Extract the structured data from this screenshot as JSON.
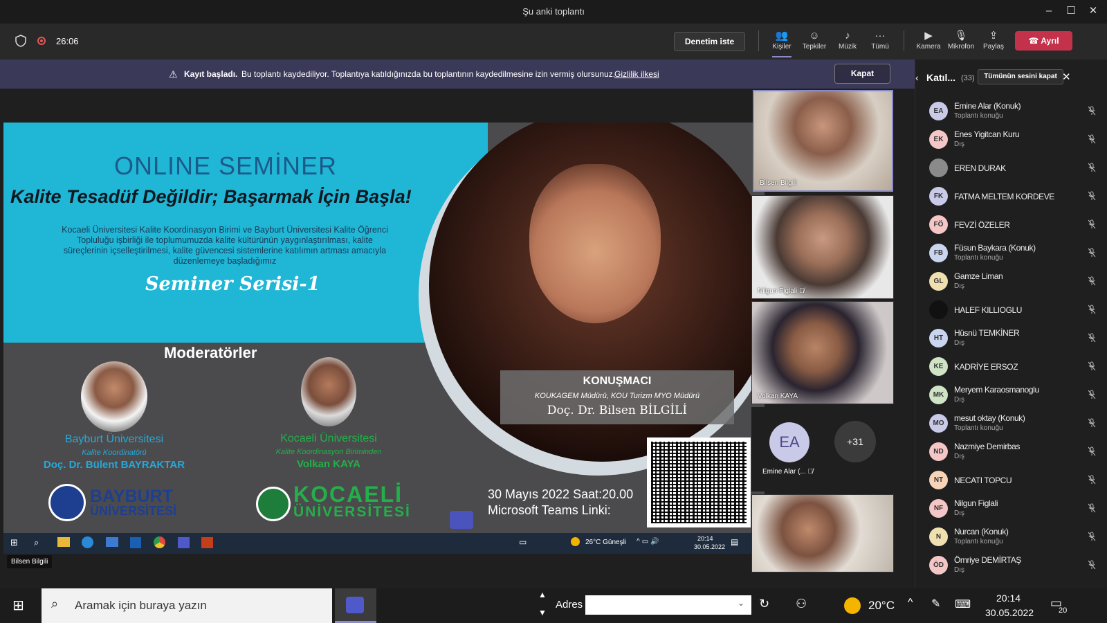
{
  "window": {
    "title": "Şu anki toplantı",
    "minimize_icon": "–",
    "maximize_icon": "☐",
    "close_icon": "✕"
  },
  "toolbar": {
    "timer": "26:06",
    "request_control": "Denetim iste",
    "buttons": [
      {
        "label": "Kişiler",
        "icon": "people-icon"
      },
      {
        "label": "Tepkiler",
        "icon": "reactions-icon"
      },
      {
        "label": "Müzik",
        "icon": "music-icon"
      },
      {
        "label": "Tümü",
        "icon": "more-icon"
      },
      {
        "label": "Kamera",
        "icon": "camera-icon"
      },
      {
        "label": "Mikrofon",
        "icon": "microphone-icon"
      },
      {
        "label": "Paylaş",
        "icon": "share-icon"
      }
    ],
    "leave": "Ayrıl"
  },
  "banner": {
    "title": "Kayıt başladı.",
    "message": "Bu toplantı kaydediliyor. Toplantıya katıldığınızda bu toplantının kaydedilmesine izin vermiş olursunuz.",
    "link": "Gizlilik ilkesi",
    "close": "Kapat"
  },
  "panel": {
    "title": "Katıl...",
    "count": "(33)",
    "mute_all": "Tümünün sesini kapat",
    "participants": [
      {
        "initials": "EA",
        "name": "Emine Alar (Konuk)",
        "role": "Toplantı konuğu",
        "color": "#c9c9e8"
      },
      {
        "initials": "EK",
        "name": "Enes Yigitcan Kuru",
        "role": "Dış",
        "color": "#f4c6c6"
      },
      {
        "initials": "",
        "name": "EREN DURAK",
        "role": "",
        "color": "#8a8a8a"
      },
      {
        "initials": "FK",
        "name": "FATMA MELTEM KORDEVE",
        "role": "",
        "color": "#c9c9e8"
      },
      {
        "initials": "FÖ",
        "name": "FEVZİ ÖZELER",
        "role": "",
        "color": "#f4c6c6"
      },
      {
        "initials": "FB",
        "name": "Füsun Baykara (Konuk)",
        "role": "Toplantı konuğu",
        "color": "#c9d4ee"
      },
      {
        "initials": "GL",
        "name": "Gamze Liman",
        "role": "Dış",
        "color": "#f0e0b0"
      },
      {
        "initials": "",
        "name": "HALEF KILLIOGLU",
        "role": "",
        "color": "#111111"
      },
      {
        "initials": "HT",
        "name": "Hüsnü TEMKİNER",
        "role": "Dış",
        "color": "#c9d4ee"
      },
      {
        "initials": "KE",
        "name": "KADRİYE ERSOZ",
        "role": "",
        "color": "#cfe3c5"
      },
      {
        "initials": "MK",
        "name": "Meryem Karaosmanoglu",
        "role": "Dış",
        "color": "#cfe3c5"
      },
      {
        "initials": "MO",
        "name": "mesut oktay (Konuk)",
        "role": "Toplantı konuğu",
        "color": "#c9c9e8"
      },
      {
        "initials": "ND",
        "name": "Nazmiye Demirbas",
        "role": "Dış",
        "color": "#f4c6c6"
      },
      {
        "initials": "NT",
        "name": "NECATI TOPCU",
        "role": "",
        "color": "#f7d3b8"
      },
      {
        "initials": "NF",
        "name": "Nilgun Figlali",
        "role": "Dış",
        "color": "#f4c6c6"
      },
      {
        "initials": "N",
        "name": "Nurcan (Konuk)",
        "role": "Toplantı konuğu",
        "color": "#f0e0b0"
      },
      {
        "initials": "ÖD",
        "name": "Ömriye DEMİRTAŞ",
        "role": "Dış",
        "color": "#f4c6c6"
      }
    ]
  },
  "videos": [
    {
      "name": "Bilsen Bilgili"
    },
    {
      "name": "Nilgun Figlali"
    },
    {
      "name": "Volkan KAYA"
    }
  ],
  "avatar_tile": {
    "initials": "EA",
    "name": "Emine Alar (...",
    "overflow": "+31"
  },
  "speaker_label": "Bilsen Bilgili",
  "slide": {
    "heading": "ONLINE SEMİNER",
    "subtitle": "Kalite Tesadüf Değildir; Başarmak İçin Başla!",
    "description": "Kocaeli Üniversitesi Kalite Koordinasyon Birimi ve Bayburt Üniversitesi Kalite Öğrenci Topluluğu işbirliği ile toplumumuzda kalite kültürünün yaygınlaştırılması, kalite süreçlerinin içselleştirilmesi, kalite güvencesi sistemlerine katılımın artması amacıyla düzenlemeye başladığımız",
    "series": "Seminer Serisi-1",
    "moderators_title": "Moderatörler",
    "mod1": {
      "uni": "Bayburt Üniversitesi",
      "role": "Kalite Koordinatörü",
      "name": "Doç. Dr. Bülent BAYRAKTAR"
    },
    "mod2": {
      "uni": "Kocaeli Üniversitesi",
      "role": "Kalite Koordinasyon Biriminden",
      "name": "Volkan KAYA"
    },
    "logo1": {
      "line1": "BAYBURT",
      "line2": "ÜNİVERSİTESİ"
    },
    "logo2": {
      "line1": "KOCAELİ",
      "line2": "ÜNİVERSİTESİ"
    },
    "speaker_title": "KONUŞMACI",
    "speaker_role": "KOUKAGEM Müdürü, KOU Turizm MYO Müdürü",
    "speaker_name": "Doç. Dr. Bilsen BİLGİLİ",
    "date": "30 Mayıs 2022 Saat:20.00",
    "teams": "Microsoft Teams Linki:"
  },
  "inner_taskbar": {
    "weather": "26°C Güneşli",
    "time": "20:14",
    "date": "30.05.2022"
  },
  "taskbar": {
    "search_placeholder": "Aramak için buraya yazın",
    "address_label": "Adres",
    "weather": "20°C",
    "time": "20:14",
    "date": "30.05.2022",
    "notifications": "20"
  }
}
